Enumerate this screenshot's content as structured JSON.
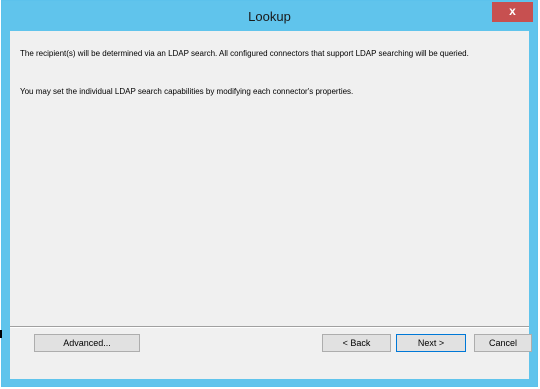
{
  "window": {
    "title": "Lookup",
    "close_label": "x"
  },
  "content": {
    "paragraph1": "The recipient(s) will be determined via an LDAP search.  All configured connectors that support LDAP searching will be queried.",
    "paragraph2": "You may set the individual LDAP search capabilities by modifying each connector's properties."
  },
  "buttons": {
    "advanced": "Advanced...",
    "back": "< Back",
    "next": "Next >",
    "cancel": "Cancel"
  },
  "colors": {
    "frame": "#60c4ec",
    "close": "#c75050",
    "background": "#f0f0f0"
  }
}
